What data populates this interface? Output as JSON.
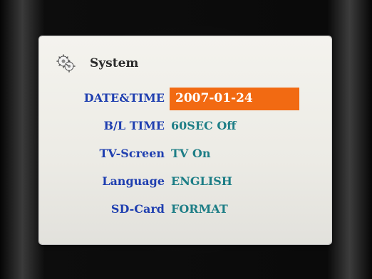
{
  "screen": {
    "title": "System",
    "icon": "gear-icon",
    "items": [
      {
        "label": "DATE&TIME",
        "value": "2007-01-24",
        "selected": true
      },
      {
        "label": "B/L TIME",
        "value": "60SEC Off",
        "selected": false
      },
      {
        "label": "TV-Screen",
        "value": "TV On",
        "selected": false
      },
      {
        "label": "Language",
        "value": "ENGLISH",
        "selected": false
      },
      {
        "label": "SD-Card",
        "value": "FORMAT",
        "selected": false
      }
    ]
  },
  "colors": {
    "label": "#1f3fb0",
    "value": "#1d7e86",
    "highlight": "#f26a12",
    "panel": "#f0efea"
  }
}
